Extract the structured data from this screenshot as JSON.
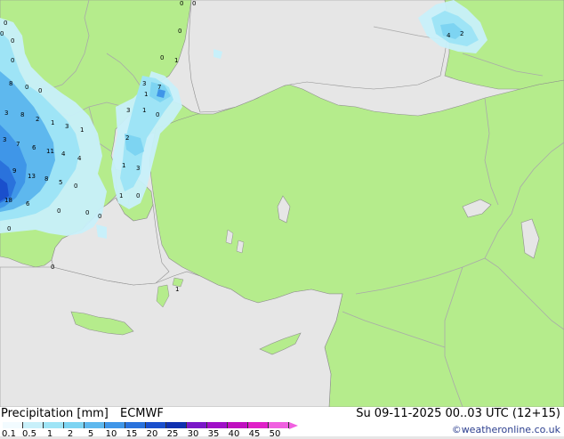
{
  "map": {
    "colors": {
      "sea": "#e6e6e6",
      "land": "#b5ec8c",
      "border": "#a9a9a9",
      "coast": "#8e8e8e"
    },
    "precip_values": [
      {
        "id": "v1",
        "text": "0"
      },
      {
        "id": "v2",
        "text": "0"
      },
      {
        "id": "v3",
        "text": "0"
      },
      {
        "id": "v4",
        "text": "1"
      },
      {
        "id": "v5",
        "text": "0"
      },
      {
        "id": "v6",
        "text": "0"
      },
      {
        "id": "v7",
        "text": "0"
      },
      {
        "id": "v8",
        "text": "4"
      },
      {
        "id": "v9",
        "text": "2"
      },
      {
        "id": "v10",
        "text": "3"
      },
      {
        "id": "v11",
        "text": "7"
      },
      {
        "id": "v12",
        "text": "8"
      },
      {
        "id": "v13",
        "text": "0"
      },
      {
        "id": "v14",
        "text": "0"
      },
      {
        "id": "v15",
        "text": "1"
      },
      {
        "id": "v16",
        "text": "3"
      },
      {
        "id": "v17",
        "text": "8"
      },
      {
        "id": "v18",
        "text": "3"
      },
      {
        "id": "v19",
        "text": "1"
      },
      {
        "id": "v20",
        "text": "3"
      },
      {
        "id": "v21",
        "text": "1"
      },
      {
        "id": "v22",
        "text": "2"
      },
      {
        "id": "v23",
        "text": "0"
      },
      {
        "id": "v24",
        "text": "2"
      },
      {
        "id": "v25",
        "text": "3"
      },
      {
        "id": "v26",
        "text": "7"
      },
      {
        "id": "v27",
        "text": "6"
      },
      {
        "id": "v28",
        "text": "11"
      },
      {
        "id": "v29",
        "text": "4"
      },
      {
        "id": "v30",
        "text": "4"
      },
      {
        "id": "v31",
        "text": "1"
      },
      {
        "id": "v32",
        "text": "3"
      },
      {
        "id": "v33",
        "text": "1"
      },
      {
        "id": "v34",
        "text": "9"
      },
      {
        "id": "v35",
        "text": "13"
      },
      {
        "id": "v36",
        "text": "8"
      },
      {
        "id": "v37",
        "text": "5"
      },
      {
        "id": "v38",
        "text": "0"
      },
      {
        "id": "v39",
        "text": "0"
      },
      {
        "id": "v40",
        "text": "1"
      },
      {
        "id": "v41",
        "text": "18"
      },
      {
        "id": "v42",
        "text": "6"
      },
      {
        "id": "v43",
        "text": "0"
      },
      {
        "id": "v44",
        "text": "0"
      },
      {
        "id": "v45",
        "text": "0"
      },
      {
        "id": "v46",
        "text": "1"
      },
      {
        "id": "v47",
        "text": "0"
      },
      {
        "id": "v48",
        "text": "0"
      },
      {
        "id": "v49",
        "text": "0"
      },
      {
        "id": "v50",
        "text": "0"
      }
    ]
  },
  "legend": {
    "title": "Precipitation [mm]",
    "model": "ECMWF",
    "valid_time": "Su 09-11-2025 00..03 UTC (12+15)",
    "credit": "©weatheronline.co.uk",
    "scale": [
      {
        "label": "0.1",
        "color": "#f2fbff"
      },
      {
        "label": "0.5",
        "color": "#c8f0fa"
      },
      {
        "label": "1",
        "color": "#9ee4f6"
      },
      {
        "label": "2",
        "color": "#7dd4f2"
      },
      {
        "label": "5",
        "color": "#5eb8ee"
      },
      {
        "label": "10",
        "color": "#3f96e8"
      },
      {
        "label": "15",
        "color": "#2a72dc"
      },
      {
        "label": "20",
        "color": "#1a4fcc"
      },
      {
        "label": "25",
        "color": "#1030b0"
      },
      {
        "label": "30",
        "color": "#7a18c8"
      },
      {
        "label": "35",
        "color": "#a010c8"
      },
      {
        "label": "40",
        "color": "#c010c0"
      },
      {
        "label": "45",
        "color": "#e020c8"
      },
      {
        "label": "50",
        "color": "#f060e0"
      }
    ]
  }
}
